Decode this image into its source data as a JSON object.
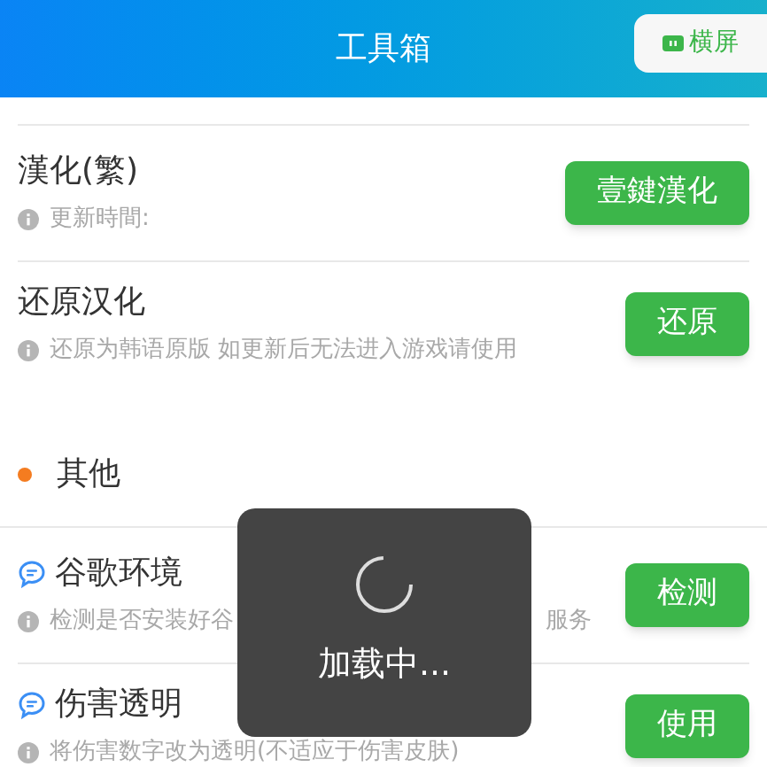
{
  "header": {
    "title": "工具箱",
    "orientation_button": "横屏"
  },
  "items": [
    {
      "kind": "plain",
      "title": "漢化(繁)",
      "note": "更新時間:",
      "button": "壹鍵漢化"
    },
    {
      "kind": "plain",
      "title": "还原汉化",
      "note": "还原为韩语原版 如更新后无法进入游戏请使用",
      "button": "还原"
    }
  ],
  "section": {
    "title": "其他",
    "items": [
      {
        "kind": "chat",
        "title": "谷歌环境",
        "note": "检测是否安装好谷",
        "note_tail": "服务",
        "button": "检测"
      },
      {
        "kind": "chat",
        "title": "伤害透明",
        "note": "将伤害数字改为透明(不适应于伤害皮肤)",
        "button": "使用"
      }
    ]
  },
  "loading": {
    "text": "加载中..."
  }
}
